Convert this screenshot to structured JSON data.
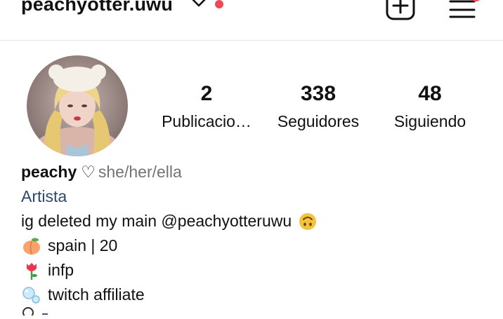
{
  "header": {
    "username": "peachyotter.uwu",
    "accent": "#ed4956"
  },
  "profile": {
    "stats": [
      {
        "count": "2",
        "label": "Publicacio…"
      },
      {
        "count": "338",
        "label": "Seguidores"
      },
      {
        "count": "48",
        "label": "Siguiendo"
      }
    ],
    "bio": {
      "name": "peachy",
      "heart": "♡",
      "pronouns": "she/her/ella",
      "category": "Artista",
      "line1": "ig deleted my main @peachyotteruwu",
      "line2": "spain | 20",
      "line3": "infp",
      "line4": "twitch affiliate"
    }
  },
  "icons": {
    "dropdown": "chevron-down-icon",
    "new_post": "plus-square-icon",
    "menu": "hamburger-menu-icon",
    "upside_down_face": "upside-down-face-emoji",
    "peach": "peach-emoji",
    "tulip": "tulip-emoji",
    "bubbles": "bubbles-emoji"
  }
}
